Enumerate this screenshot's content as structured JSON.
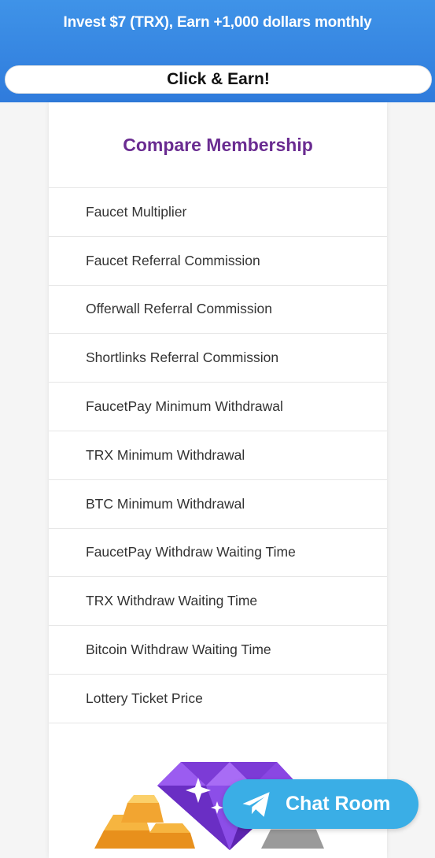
{
  "banner": {
    "title": "Invest $7 (TRX), Earn +1,000 dollars monthly",
    "cta_label": "Click & Earn!"
  },
  "membership": {
    "title": "Compare Membership",
    "features": [
      "Faucet Multiplier",
      "Faucet Referral Commission",
      "Offerwall Referral Commission",
      "Shortlinks Referral Commission",
      "FaucetPay Minimum Withdrawal",
      "TRX Minimum Withdrawal",
      "BTC Minimum Withdrawal",
      "FaucetPay Withdraw Waiting Time",
      "TRX Withdraw Waiting Time",
      "Bitcoin Withdraw Waiting Time",
      "Lottery Ticket Price"
    ]
  },
  "chat": {
    "label": "Chat Room",
    "icon": "telegram-plane-icon"
  },
  "illustration": {
    "icons": [
      "gold-bars-icon",
      "diamond-icon",
      "silver-bars-icon"
    ]
  },
  "colors": {
    "banner": "#2f7bdc",
    "title": "#6a2c91",
    "chat_button": "#3aaee6",
    "diamond": "#7c3bd6",
    "gold": "#f2a531"
  }
}
